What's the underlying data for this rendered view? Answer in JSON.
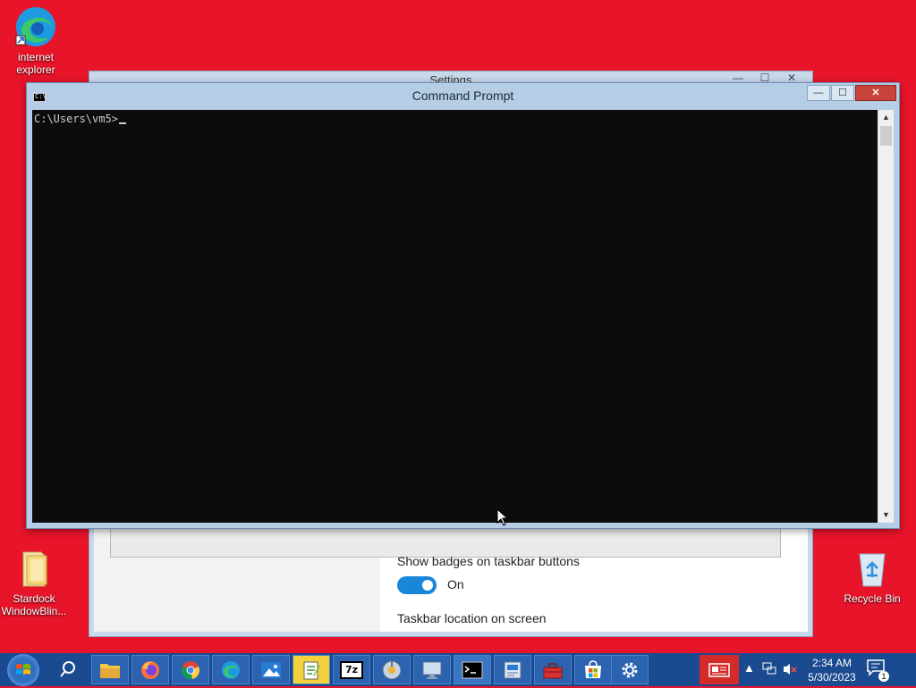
{
  "desktop": {
    "icons": [
      {
        "label": "internet explorer"
      },
      {
        "label": "Stardock WindowBlin..."
      },
      {
        "label": "Recycle Bin"
      }
    ]
  },
  "settings_window": {
    "title": "Settings",
    "options": {
      "badges_label": "Show badges on taskbar buttons",
      "badges_state": "On",
      "location_label": "Taskbar location on screen"
    }
  },
  "cmd_window": {
    "title": "Command Prompt",
    "prompt": "C:\\Users\\vm5>",
    "minimize_glyph": "—",
    "maximize_glyph": "☐",
    "close_glyph": "✕"
  },
  "taskbar": {
    "apps": [
      {
        "name": "file-explorer"
      },
      {
        "name": "firefox"
      },
      {
        "name": "chrome"
      },
      {
        "name": "edge"
      },
      {
        "name": "photos"
      },
      {
        "name": "notepad-plus"
      },
      {
        "name": "7zip",
        "label": "7z"
      },
      {
        "name": "disk-utility"
      },
      {
        "name": "remote-desktop"
      },
      {
        "name": "command-prompt"
      },
      {
        "name": "network-app"
      },
      {
        "name": "toolbox"
      },
      {
        "name": "microsoft-store"
      },
      {
        "name": "settings"
      }
    ],
    "clock": {
      "time": "2:34 AM",
      "date": "5/30/2023"
    },
    "notification_count": "1"
  },
  "colors": {
    "desktop_bg": "#e8142a",
    "taskbar_bg": "#1a4a8f",
    "toggle_on": "#1a86d9"
  }
}
